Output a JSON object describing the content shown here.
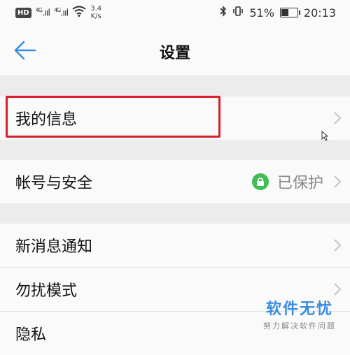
{
  "status_bar": {
    "hd": "HD",
    "net1": "4G",
    "net2": "4G",
    "speed_value": "3.4",
    "speed_unit": "K/s",
    "battery_percent": "51%",
    "battery_level": 0.51,
    "time": "20:13"
  },
  "header": {
    "title": "设置",
    "back_icon": "back-arrow-icon"
  },
  "rows": {
    "my_info": {
      "label": "我的信息"
    },
    "account_security": {
      "label": "帐号与安全",
      "status": "已保护",
      "status_icon": "lock-icon"
    },
    "notifications": {
      "label": "新消息通知"
    },
    "dnd": {
      "label": "勿扰模式"
    },
    "privacy": {
      "label": "隐私"
    }
  },
  "watermark": {
    "brand": "软件无忧",
    "sub": "努力解决软件问题"
  },
  "colors": {
    "accent": "#3a8de0",
    "highlight": "#d6212a",
    "lock_green": "#3fbe54"
  }
}
